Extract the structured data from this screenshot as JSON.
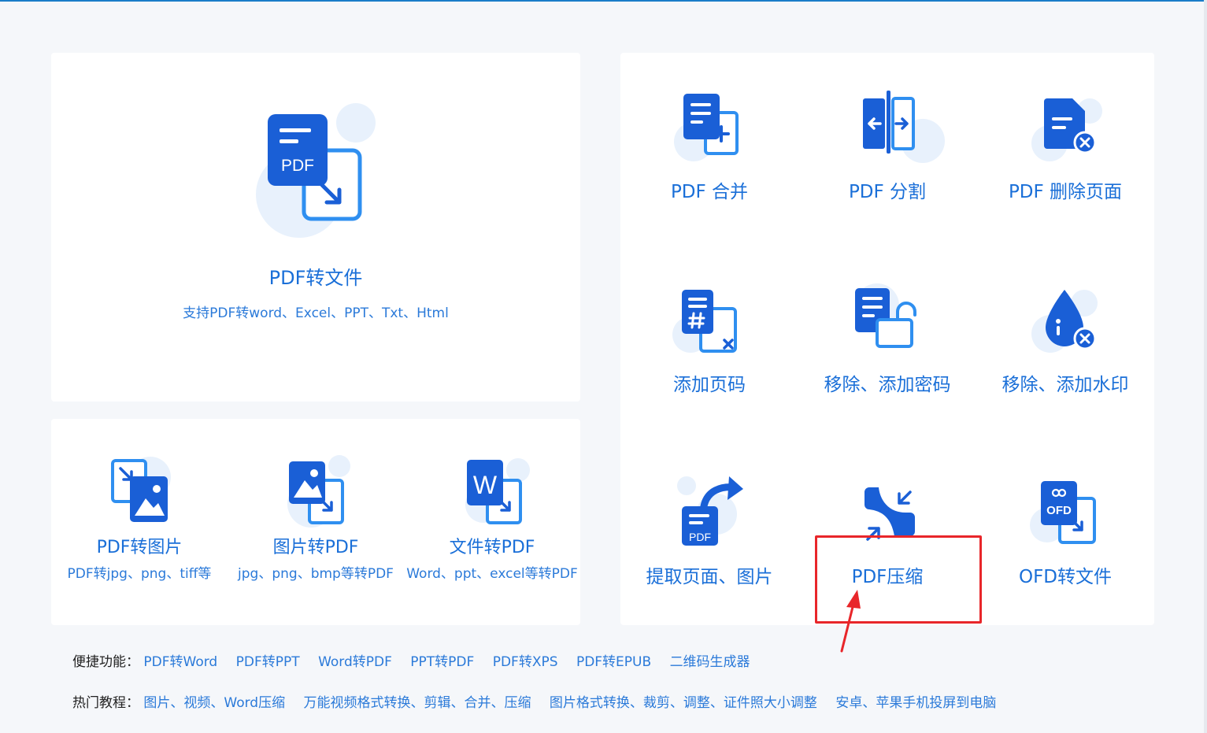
{
  "colors": {
    "primary": "#1a6fd8",
    "icon_dark": "#1a5fd6",
    "icon_light": "#2f8ff0",
    "bubble": "#e8f1fc",
    "highlight": "#e8262a"
  },
  "convert_card": {
    "icon": "pdf-convert-icon",
    "icon_text": "PDF",
    "title": "PDF转文件",
    "subtitle": "支持PDF转word、Excel、PPT、Txt、Html"
  },
  "small_tools": [
    {
      "icon": "pdf-to-image-icon",
      "title": "PDF转图片",
      "subtitle": "PDF转jpg、png、tiff等"
    },
    {
      "icon": "image-to-pdf-icon",
      "title": "图片转PDF",
      "subtitle": "jpg、png、bmp等转PDF"
    },
    {
      "icon": "word-to-pdf-icon",
      "icon_text": "W",
      "title": "文件转PDF",
      "subtitle": "Word、ppt、excel等转PDF"
    }
  ],
  "grid_tools": [
    {
      "icon": "pdf-merge-icon",
      "label": "PDF 合并"
    },
    {
      "icon": "pdf-split-icon",
      "label": "PDF 分割"
    },
    {
      "icon": "pdf-delete-page-icon",
      "label": "PDF 删除页面"
    },
    {
      "icon": "page-number-icon",
      "label": "添加页码"
    },
    {
      "icon": "password-lock-icon",
      "label": "移除、添加密码"
    },
    {
      "icon": "watermark-drop-icon",
      "label": "移除、添加水印"
    },
    {
      "icon": "extract-page-icon",
      "icon_text": "PDF",
      "label": "提取页面、图片"
    },
    {
      "icon": "pdf-compress-icon",
      "label": "PDF压缩"
    },
    {
      "icon": "ofd-convert-icon",
      "icon_text": "OFD",
      "label": "OFD转文件"
    }
  ],
  "quick_links": {
    "label": "便捷功能：",
    "items": [
      "PDF转Word",
      "PDF转PPT",
      "Word转PDF",
      "PPT转PDF",
      "PDF转XPS",
      "PDF转EPUB",
      "二维码生成器"
    ]
  },
  "tutorials": {
    "label": "热门教程：",
    "items": [
      "图片、视频、Word压缩",
      "万能视频格式转换、剪辑、合并、压缩",
      "图片格式转换、裁剪、调整、证件照大小调整",
      "安卓、苹果手机投屏到电脑"
    ]
  }
}
